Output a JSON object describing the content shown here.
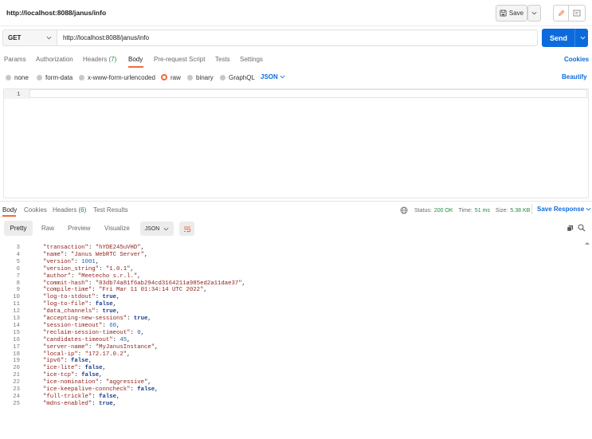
{
  "window": {
    "title": "http://localhost:8088/janus/info",
    "save_label": "Save"
  },
  "request": {
    "method": "GET",
    "url": "http://localhost:8088/janus/info",
    "send_label": "Send"
  },
  "request_tabs": [
    {
      "label": "Params"
    },
    {
      "label": "Authorization"
    },
    {
      "label": "Headers",
      "count": "(7)"
    },
    {
      "label": "Body"
    },
    {
      "label": "Pre-request Script"
    },
    {
      "label": "Tests"
    },
    {
      "label": "Settings"
    }
  ],
  "cookies_label": "Cookies",
  "body_types": [
    {
      "label": "none"
    },
    {
      "label": "form-data"
    },
    {
      "label": "x-www-form-urlencoded"
    },
    {
      "label": "raw",
      "selected": true
    },
    {
      "label": "binary"
    },
    {
      "label": "GraphQL"
    }
  ],
  "body_format": "JSON",
  "beautify_label": "Beautify",
  "editor": {
    "line": "1"
  },
  "response_tabs": [
    {
      "label": "Body"
    },
    {
      "label": "Cookies"
    },
    {
      "label": "Headers",
      "count": "(6)"
    },
    {
      "label": "Test Results"
    }
  ],
  "response_status": {
    "status_label": "Status:",
    "status_value": "200 OK",
    "time_label": "Time:",
    "time_value": "51 ms",
    "size_label": "Size:",
    "size_value": "5.38 KB"
  },
  "save_response_label": "Save Response",
  "view_tabs": [
    {
      "label": "Pretty"
    },
    {
      "label": "Raw"
    },
    {
      "label": "Preview"
    },
    {
      "label": "Visualize"
    }
  ],
  "response_format": "JSON",
  "response_lines": [
    {
      "n": "3",
      "key": "\"transaction\"",
      "val": "\"hYDE245uVHD\"",
      "type": "s"
    },
    {
      "n": "4",
      "key": "\"name\"",
      "val": "\"Janus WebRTC Server\"",
      "type": "s"
    },
    {
      "n": "5",
      "key": "\"version\"",
      "val": "1001",
      "type": "n"
    },
    {
      "n": "6",
      "key": "\"version_string\"",
      "val": "\"1.0.1\"",
      "type": "s"
    },
    {
      "n": "7",
      "key": "\"author\"",
      "val": "\"Meetecho s.r.l.\"",
      "type": "s"
    },
    {
      "n": "8",
      "key": "\"commit-hash\"",
      "val": "\"03db74a81f6ab294cd3164211a985ed2a11dae37\"",
      "type": "s"
    },
    {
      "n": "9",
      "key": "\"compile-time\"",
      "val": "\"Fri Mar 11 01:34:14 UTC 2022\"",
      "type": "s"
    },
    {
      "n": "10",
      "key": "\"log-to-stdout\"",
      "val": "true",
      "type": "b"
    },
    {
      "n": "11",
      "key": "\"log-to-file\"",
      "val": "false",
      "type": "b"
    },
    {
      "n": "12",
      "key": "\"data_channels\"",
      "val": "true",
      "type": "b"
    },
    {
      "n": "13",
      "key": "\"accepting-new-sessions\"",
      "val": "true",
      "type": "b"
    },
    {
      "n": "14",
      "key": "\"session-timeout\"",
      "val": "60",
      "type": "n"
    },
    {
      "n": "15",
      "key": "\"reclaim-session-timeout\"",
      "val": "0",
      "type": "n"
    },
    {
      "n": "16",
      "key": "\"candidates-timeout\"",
      "val": "45",
      "type": "n"
    },
    {
      "n": "17",
      "key": "\"server-name\"",
      "val": "\"MyJanusInstance\"",
      "type": "s"
    },
    {
      "n": "18",
      "key": "\"local-ip\"",
      "val": "\"172.17.0.2\"",
      "type": "s"
    },
    {
      "n": "19",
      "key": "\"ipv6\"",
      "val": "false",
      "type": "b"
    },
    {
      "n": "20",
      "key": "\"ice-lite\"",
      "val": "false",
      "type": "b"
    },
    {
      "n": "21",
      "key": "\"ice-tcp\"",
      "val": "false",
      "type": "b"
    },
    {
      "n": "22",
      "key": "\"ice-nomination\"",
      "val": "\"aggressive\"",
      "type": "s"
    },
    {
      "n": "23",
      "key": "\"ice-keepalive-conncheck\"",
      "val": "false",
      "type": "b"
    },
    {
      "n": "24",
      "key": "\"full-trickle\"",
      "val": "false",
      "type": "b"
    },
    {
      "n": "25",
      "key": "\"mdns-enabled\"",
      "val": "true",
      "type": "b"
    }
  ],
  "colors": {
    "accent": "#f26b3a",
    "primary": "#0c6bdc",
    "success": "#1f8a3f"
  }
}
